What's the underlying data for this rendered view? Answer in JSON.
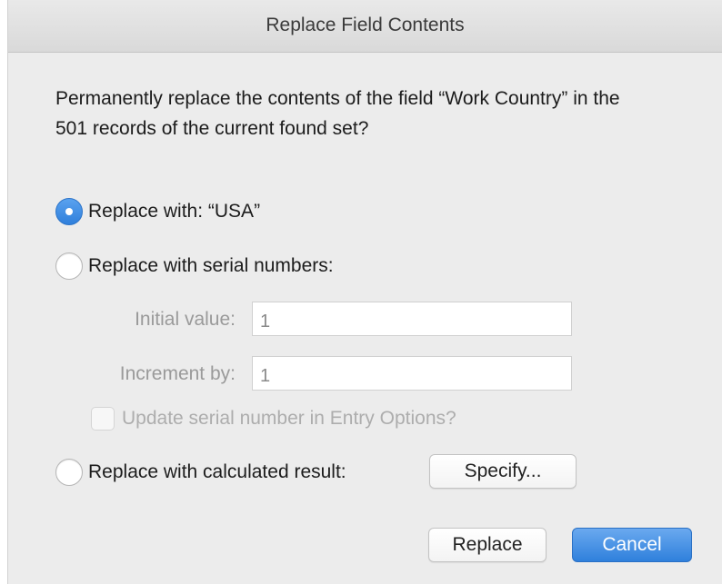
{
  "dialog": {
    "title": "Replace Field Contents",
    "prompt": "Permanently replace the contents of the field “Work Country” in the 501 records of the current found set?"
  },
  "options": {
    "replace_with": {
      "label": "Replace with: “USA”",
      "selected": true
    },
    "serial_numbers": {
      "label": "Replace with serial numbers:",
      "selected": false,
      "initial_value_label": "Initial value:",
      "initial_value": "1",
      "increment_label": "Increment by:",
      "increment_value": "1",
      "update_checkbox_label": "Update serial number in Entry Options?",
      "update_checked": false
    },
    "calculated": {
      "label": "Replace with calculated result:",
      "selected": false,
      "specify_label": "Specify..."
    }
  },
  "buttons": {
    "replace_label": "Replace",
    "cancel_label": "Cancel"
  },
  "colors": {
    "accent": "#2f80dc",
    "dialog_bg": "#ececec",
    "disabled_text": "#9a9a9a"
  }
}
